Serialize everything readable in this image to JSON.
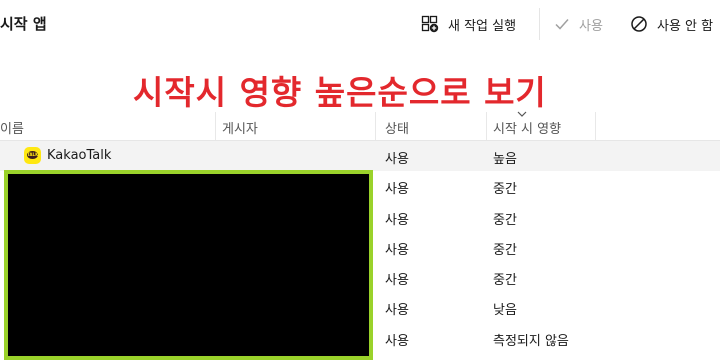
{
  "header": {
    "title": "시작 앱",
    "new_task_label": "새 작업 실행",
    "enable_label": "사용",
    "disable_label": "사용 안 함"
  },
  "overlay": {
    "headline": "시작시 영향 높은순으로 보기"
  },
  "table": {
    "columns": [
      "이름",
      "게시자",
      "상태",
      "시작 시 영향"
    ],
    "sort_column": "시작 시 영향",
    "rows": [
      {
        "name": "KakaoTalk",
        "publisher": "",
        "status": "사용",
        "impact": "높음",
        "icon": "kakaotalk-icon"
      },
      {
        "name": "",
        "publisher": "",
        "status": "사용",
        "impact": "중간"
      },
      {
        "name": "",
        "publisher": "",
        "status": "사용",
        "impact": "중간"
      },
      {
        "name": "",
        "publisher": "",
        "status": "사용",
        "impact": "중간"
      },
      {
        "name": "",
        "publisher": "",
        "status": "사용",
        "impact": "중간"
      },
      {
        "name": "",
        "publisher": "",
        "status": "사용",
        "impact": "낮음"
      },
      {
        "name": "",
        "publisher": "",
        "status": "사용",
        "impact": "측정되지 않음"
      }
    ]
  },
  "colors": {
    "headline": "#e3282d",
    "redaction_border": "#9ad22a",
    "kakao_yellow": "#ffe812"
  }
}
